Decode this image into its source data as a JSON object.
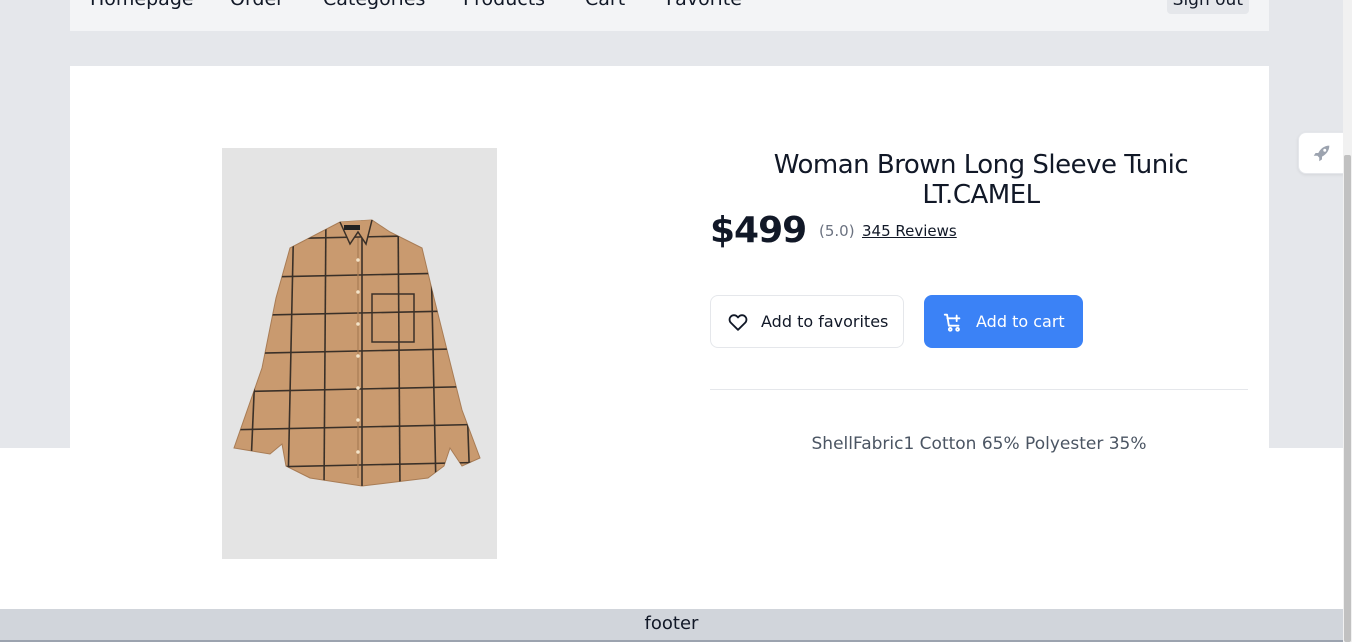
{
  "nav": {
    "items": [
      "Homepage",
      "Order",
      "Categories",
      "Products",
      "Cart",
      "Favorite"
    ],
    "signout": "Sign out"
  },
  "product": {
    "title": "Woman Brown Long Sleeve Tunic LT.CAMEL",
    "price": "$499",
    "rating": "(5.0)",
    "reviews": "345 Reviews",
    "favorite_label": "Add to favorites",
    "cart_label": "Add to cart",
    "description": "ShellFabric1 Cotton 65% Polyester 35%",
    "image_icon": "plaid-shirt-image"
  },
  "footer": {
    "text": "footer"
  },
  "colors": {
    "accent": "#3b82f6",
    "page_band": "#e5e7eb",
    "shirt": "#c99a6f",
    "shirt_grid": "#3a3028"
  }
}
